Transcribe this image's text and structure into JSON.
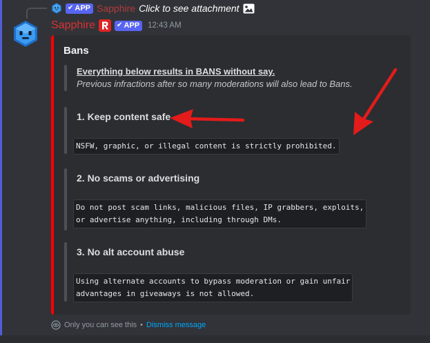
{
  "reply": {
    "badge_label": "APP",
    "author": "Sapphire",
    "text": "Click to see attachment",
    "avatar_icon": "sapphire-bot-avatar",
    "attachment_icon": "image-icon"
  },
  "message": {
    "author": "Sapphire",
    "author_color": "#d93232",
    "role_icon": "r-role-icon",
    "badge_label": "APP",
    "timestamp": "12:43 AM"
  },
  "embed": {
    "accent_color": "#ff0000",
    "title": "Bans",
    "warning": {
      "heading": "Everything below results in BANS without say.",
      "subtext": "Previous infractions after so many moderations will also lead to Bans."
    },
    "rules": [
      {
        "title": "1. Keep content safe",
        "code_lines": [
          "NSFW, graphic, or illegal content is strictly prohibited."
        ]
      },
      {
        "title": "2. No scams or advertising",
        "code_lines": [
          "Do not post scam links, malicious files, IP grabbers, exploits,",
          "or advertise anything, including through DMs."
        ]
      },
      {
        "title": "3. No alt account abuse",
        "code_lines": [
          "Using alternate accounts to bypass moderation or gain unfair",
          "advantages in giveaways is not allowed."
        ]
      }
    ]
  },
  "ephemeral": {
    "note": "Only you can see this",
    "separator": "•",
    "dismiss_label": "Dismiss message"
  },
  "colors": {
    "background": "#313338",
    "embed_background": "#2b2d31",
    "blurple": "#5865f2",
    "annotation_arrow": "#e31b1b",
    "link": "#00a8fc"
  }
}
